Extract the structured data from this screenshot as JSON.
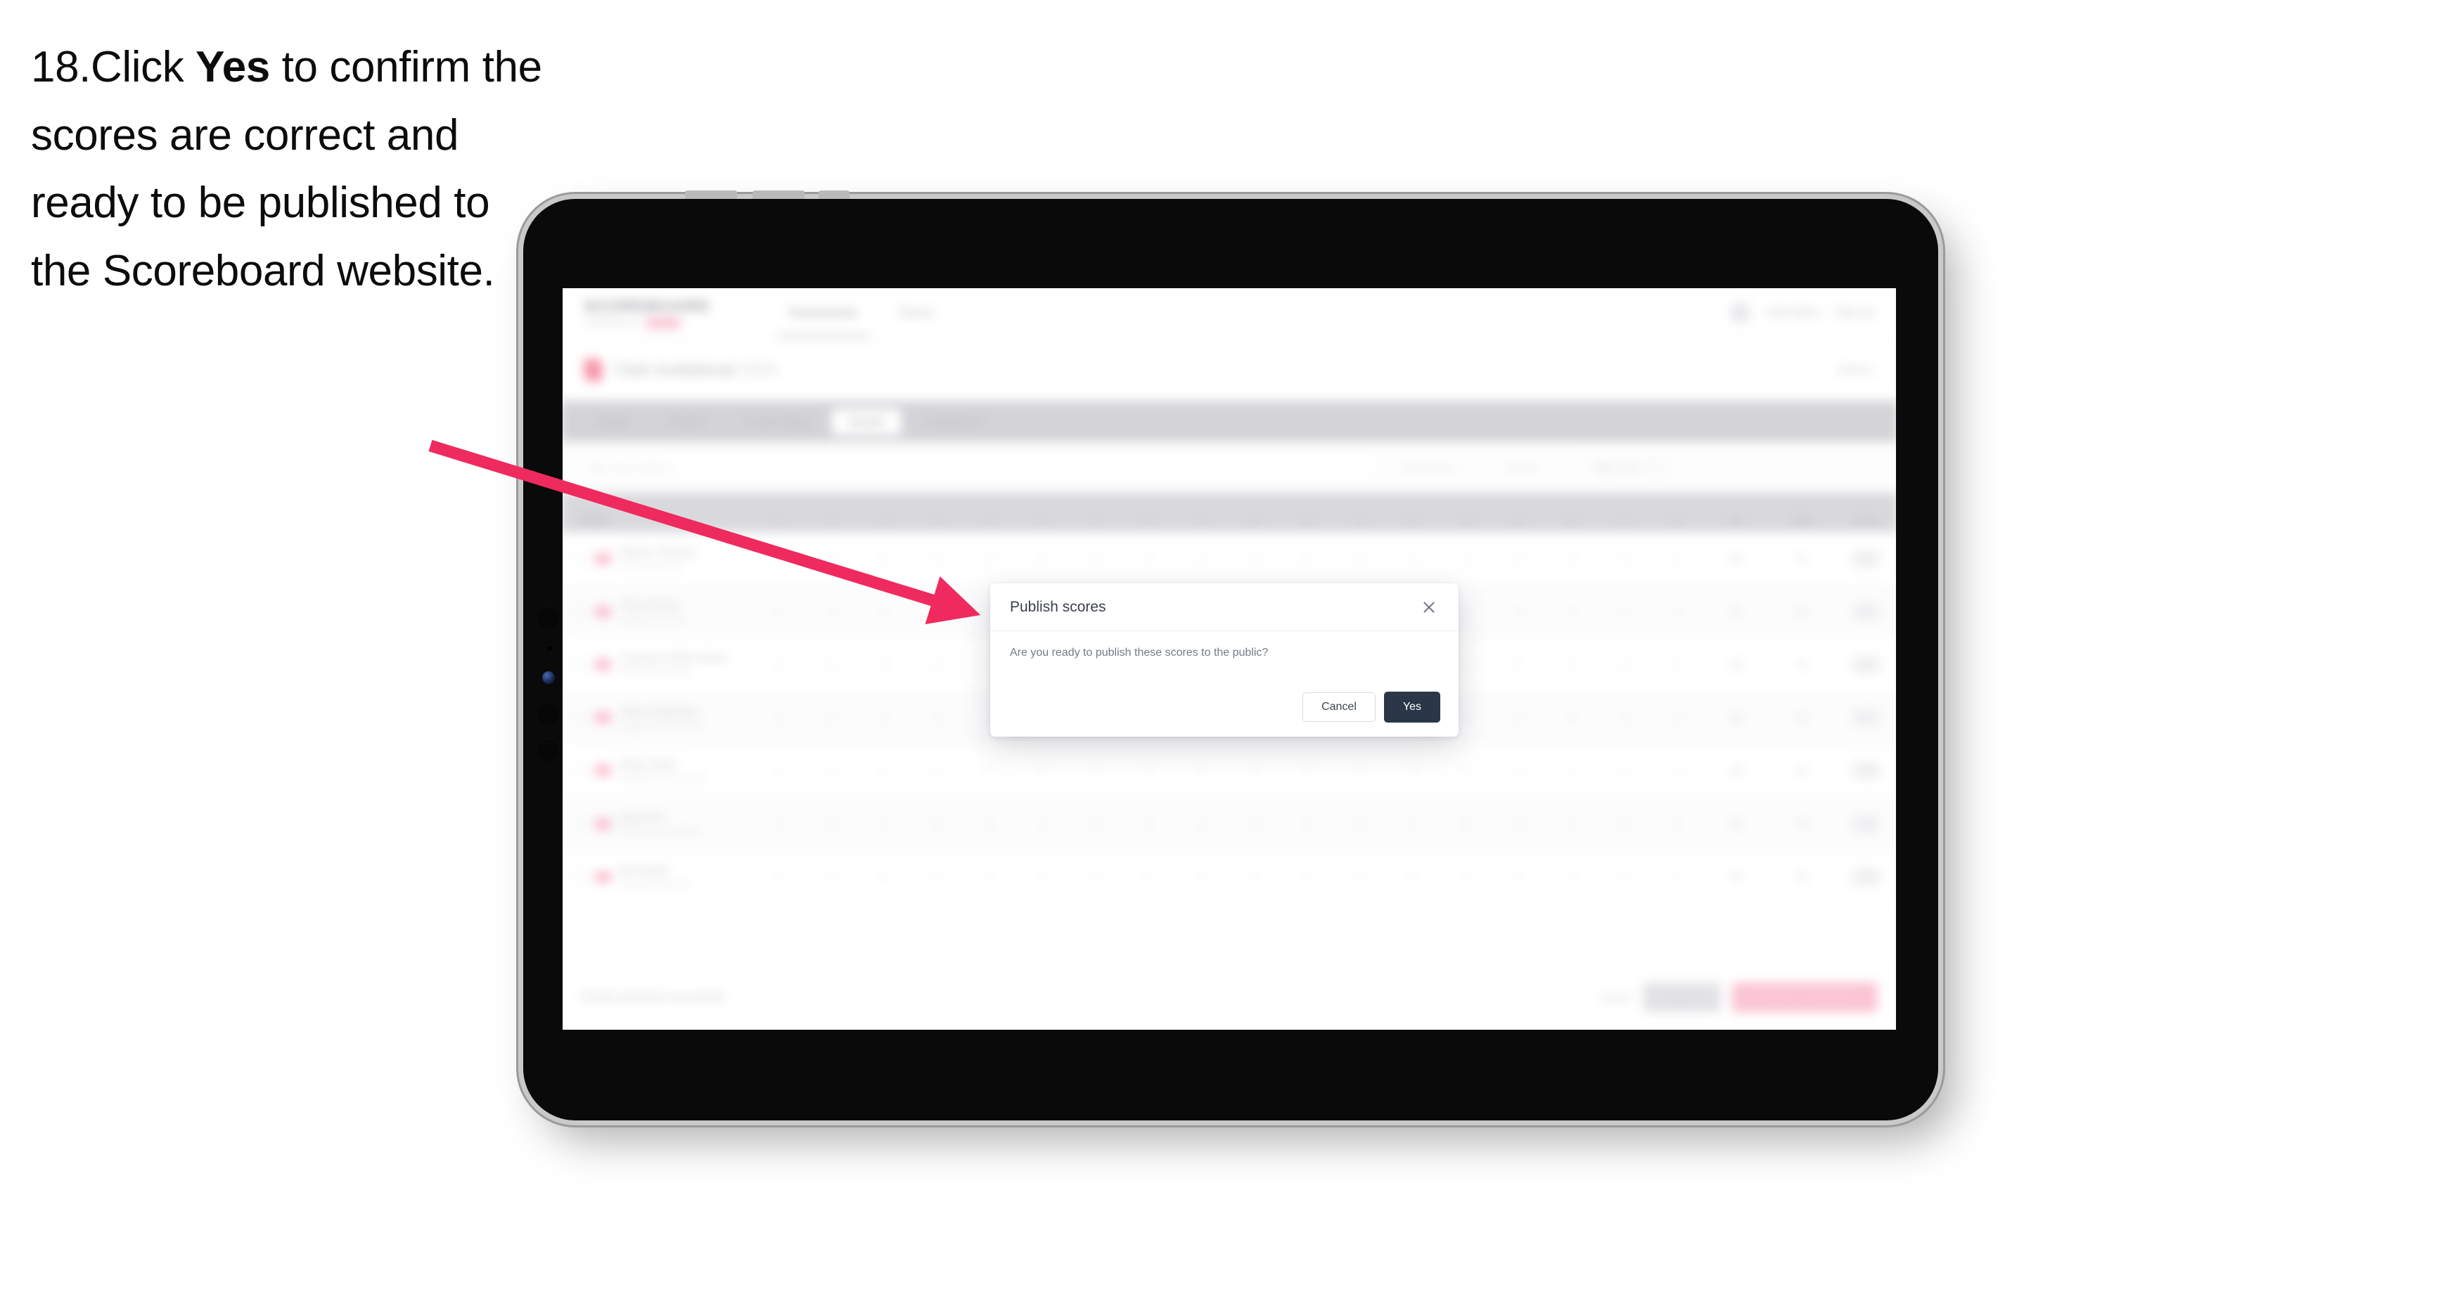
{
  "instruction": {
    "step_number": "18.",
    "part1": "Click ",
    "bold": "Yes",
    "part2": " to confirm the scores are correct and ready to be published to the Scoreboard website."
  },
  "colors": {
    "arrow": "#ef2a5e",
    "primary_button": "#2b3648",
    "brand_pink": "#f2738f",
    "device_body": "#0a0a0a",
    "device_bezel": "#c9c9c9"
  },
  "app": {
    "header": {
      "brand_name": "SCOREBOARD",
      "brand_sub": "POWERED BY",
      "brand_pill": "GOLF",
      "nav": [
        {
          "label": "Tournaments",
          "active": true
        },
        {
          "label": "Teams",
          "active": false
        }
      ],
      "user_name": "Club Admin",
      "sign_out": "Sign out"
    },
    "competition": {
      "title": "Club Invitational",
      "title_dim": "2024",
      "right_label": "Event 1"
    },
    "tabs": [
      {
        "label": "Details",
        "active": false
      },
      {
        "label": "Rounds",
        "active": false
      },
      {
        "label": "Course Setup",
        "active": false
      },
      {
        "label": "Results",
        "active": true
      },
      {
        "label": "Leaderboard",
        "active": false
      }
    ],
    "filters": {
      "search_placeholder": "Search players",
      "tee_filter": "All Divisions",
      "round_filter": "Round 1",
      "view_filter": "Table View"
    },
    "table": {
      "player_header": "Player",
      "hole_headers": [
        "1",
        "2",
        "3",
        "4",
        "5",
        "6",
        "7",
        "8",
        "9",
        "10",
        "11",
        "12",
        "13",
        "14",
        "15",
        "16",
        "17",
        "18"
      ],
      "summary_headers": [
        "IN",
        "Total",
        "Score"
      ],
      "rows": [
        {
          "name": "Warren Thomas",
          "club": "Sunrise Golf Club",
          "holes": [
            "4",
            "5",
            "4",
            "3",
            "4",
            "5",
            "4",
            "3",
            "4",
            "4",
            "5",
            "3",
            "4",
            "4",
            "5",
            "4",
            "3",
            "4"
          ],
          "in": "36",
          "total": "72",
          "score": "+2"
        },
        {
          "name": "Piers Parrott",
          "club": "Lakeside Golf Club",
          "holes": [
            "5",
            "4",
            "4",
            "4",
            "3",
            "5",
            "4",
            "4",
            "4",
            "5",
            "4",
            "4",
            "3",
            "5",
            "4",
            "4",
            "4",
            "3"
          ],
          "in": "37",
          "total": "73",
          "score": "+3"
        },
        {
          "name": "Cameron Parker-Davis",
          "club": "Riverbend Golf Club",
          "holes": [
            "4",
            "4",
            "5",
            "3",
            "4",
            "4",
            "5",
            "4",
            "3",
            "4",
            "4",
            "5",
            "4",
            "3",
            "5",
            "4",
            "4",
            "4"
          ],
          "in": "36",
          "total": "73",
          "score": "+3"
        },
        {
          "name": "Oliver Robertson",
          "club": "Highland Park Golf Club",
          "holes": [
            "4",
            "5",
            "4",
            "4",
            "4",
            "5",
            "3",
            "4",
            "4",
            "4",
            "5",
            "4",
            "4",
            "4",
            "4",
            "5",
            "3",
            "4"
          ],
          "in": "38",
          "total": "74",
          "score": "+4"
        },
        {
          "name": "Ethan Ward",
          "club": "Westbrook Country Club",
          "holes": [
            "5",
            "4",
            "4",
            "4",
            "5",
            "4",
            "4",
            "3",
            "5",
            "4",
            "4",
            "4",
            "5",
            "4",
            "4",
            "3",
            "5",
            "4"
          ],
          "in": "38",
          "total": "75",
          "score": "+5"
        },
        {
          "name": "Ryan Hill",
          "club": "Oakmoor Golf Academy",
          "holes": [
            "4",
            "5",
            "5",
            "4",
            "4",
            "4",
            "4",
            "5",
            "4",
            "4",
            "5",
            "4",
            "4",
            "5",
            "4",
            "4",
            "4",
            "5"
          ],
          "in": "39",
          "total": "76",
          "score": "+6"
        },
        {
          "name": "Ben Butler",
          "club": "Greenfield Golf Club",
          "holes": [
            "5",
            "5",
            "4",
            "4",
            "5",
            "4",
            "5",
            "4",
            "4",
            "5",
            "4",
            "5",
            "4",
            "4",
            "5",
            "4",
            "5",
            "4"
          ],
          "in": "40",
          "total": "78",
          "score": "+8"
        }
      ]
    },
    "footer": {
      "note": "Results published successfully",
      "link": "Cancel",
      "secondary_button": "Save All",
      "primary_button": "Publish to Scoreboard"
    }
  },
  "modal": {
    "title": "Publish scores",
    "message": "Are you ready to publish these scores to the public?",
    "cancel_label": "Cancel",
    "confirm_label": "Yes",
    "close_icon": "close-icon"
  }
}
